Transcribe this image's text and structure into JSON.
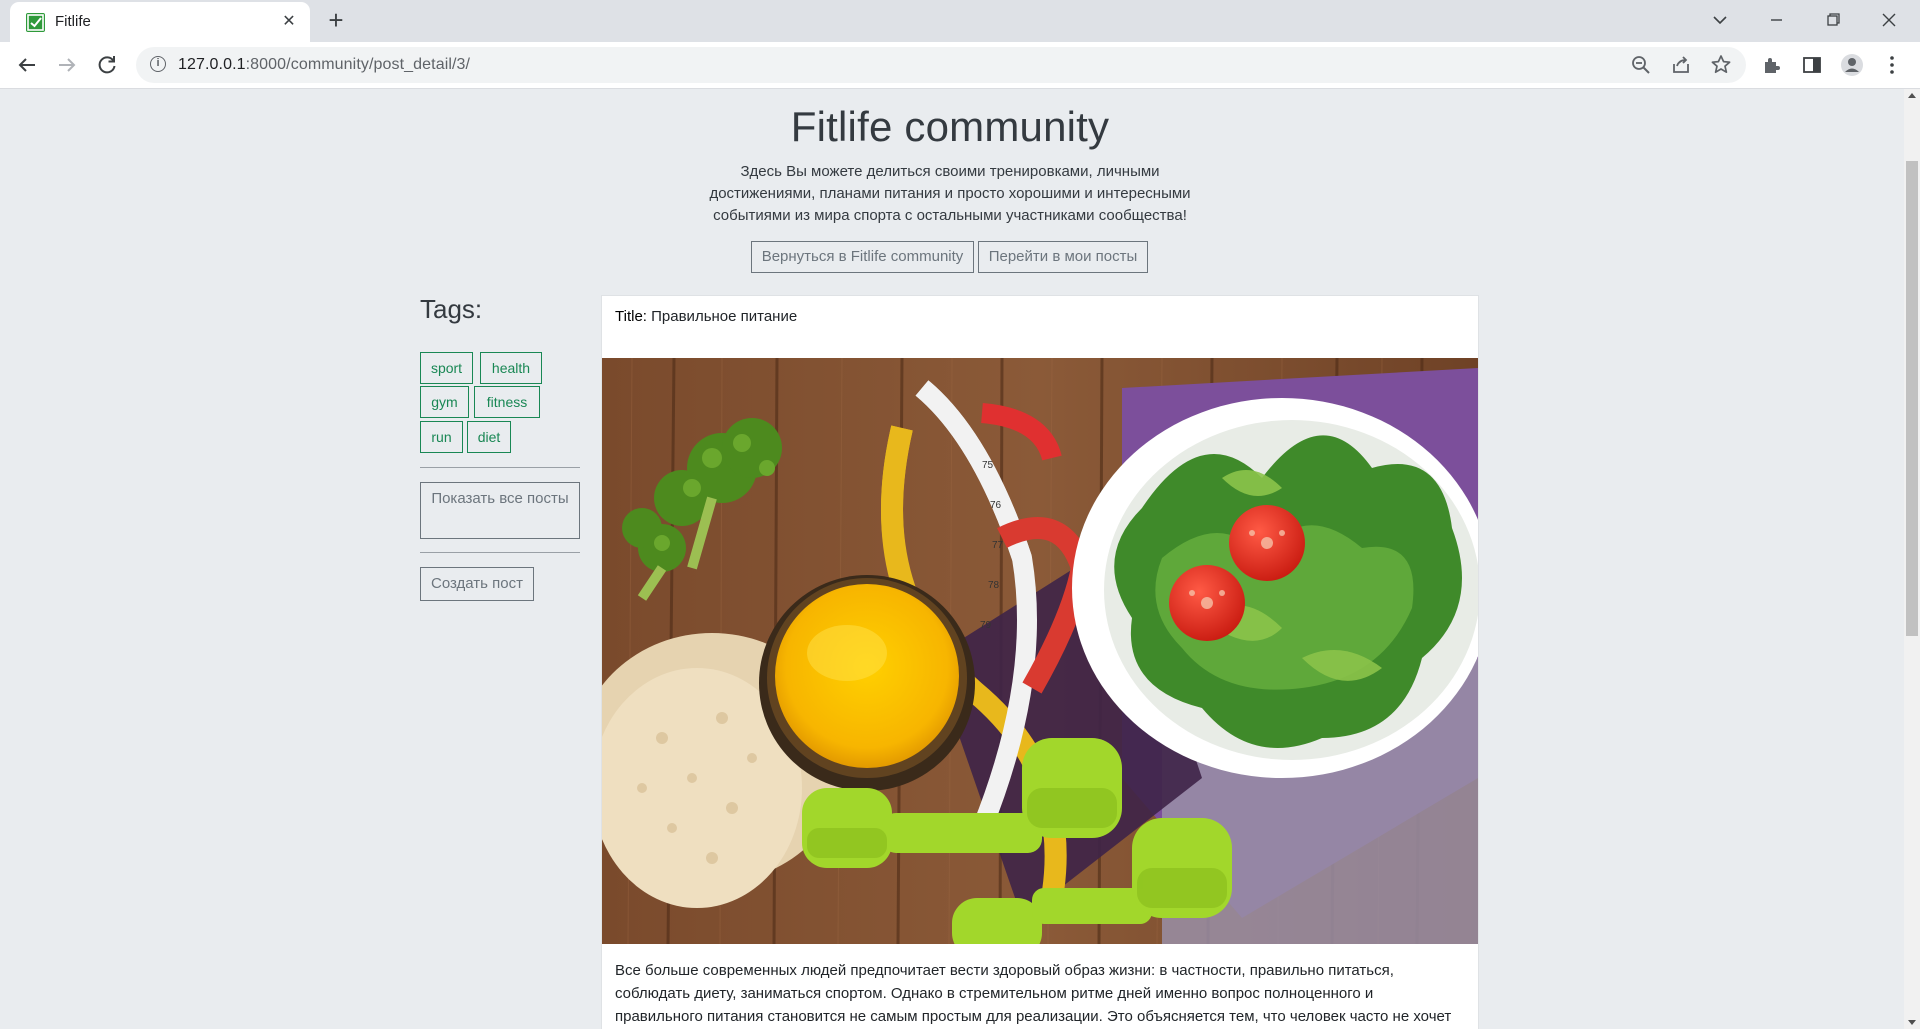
{
  "browser": {
    "tab_title": "Fitlife",
    "url_host": "127.0.0.1",
    "url_path": ":8000/community/post_detail/3/"
  },
  "hero": {
    "title": "Fitlife community",
    "subtitle": "Здесь Вы можете делиться своими тренировками, личными достижениями, планами питания и просто хорошими и интересными событиями из мира спорта с остальными участниками сообщества!",
    "back_button": "Вернуться в Fitlife community",
    "my_posts_button": "Перейти в мои посты"
  },
  "sidebar": {
    "heading": "Tags:",
    "tags": [
      "sport",
      "health",
      "gym",
      "fitness",
      "run",
      "diet"
    ],
    "show_all_button": "Показать все посты",
    "create_post_button": "Создать пост"
  },
  "post": {
    "title_label": "Title:",
    "title": "Правильное питание",
    "image_description": "healthy food, measuring tape, dumbbells",
    "body": "Все больше современных людей предпочитает вести здоровый образ жизни: в частности, правильно питаться, соблюдать диету, заниматься спортом. Однако в стремительном ритме дней именно вопрос полноценного и правильного питания становится не самым простым для реализации. Это объясняется тем, что человек часто не хочет"
  },
  "colors": {
    "tag_green": "#198754",
    "page_bg": "#e9ecef",
    "secondary": "#6c757d"
  }
}
